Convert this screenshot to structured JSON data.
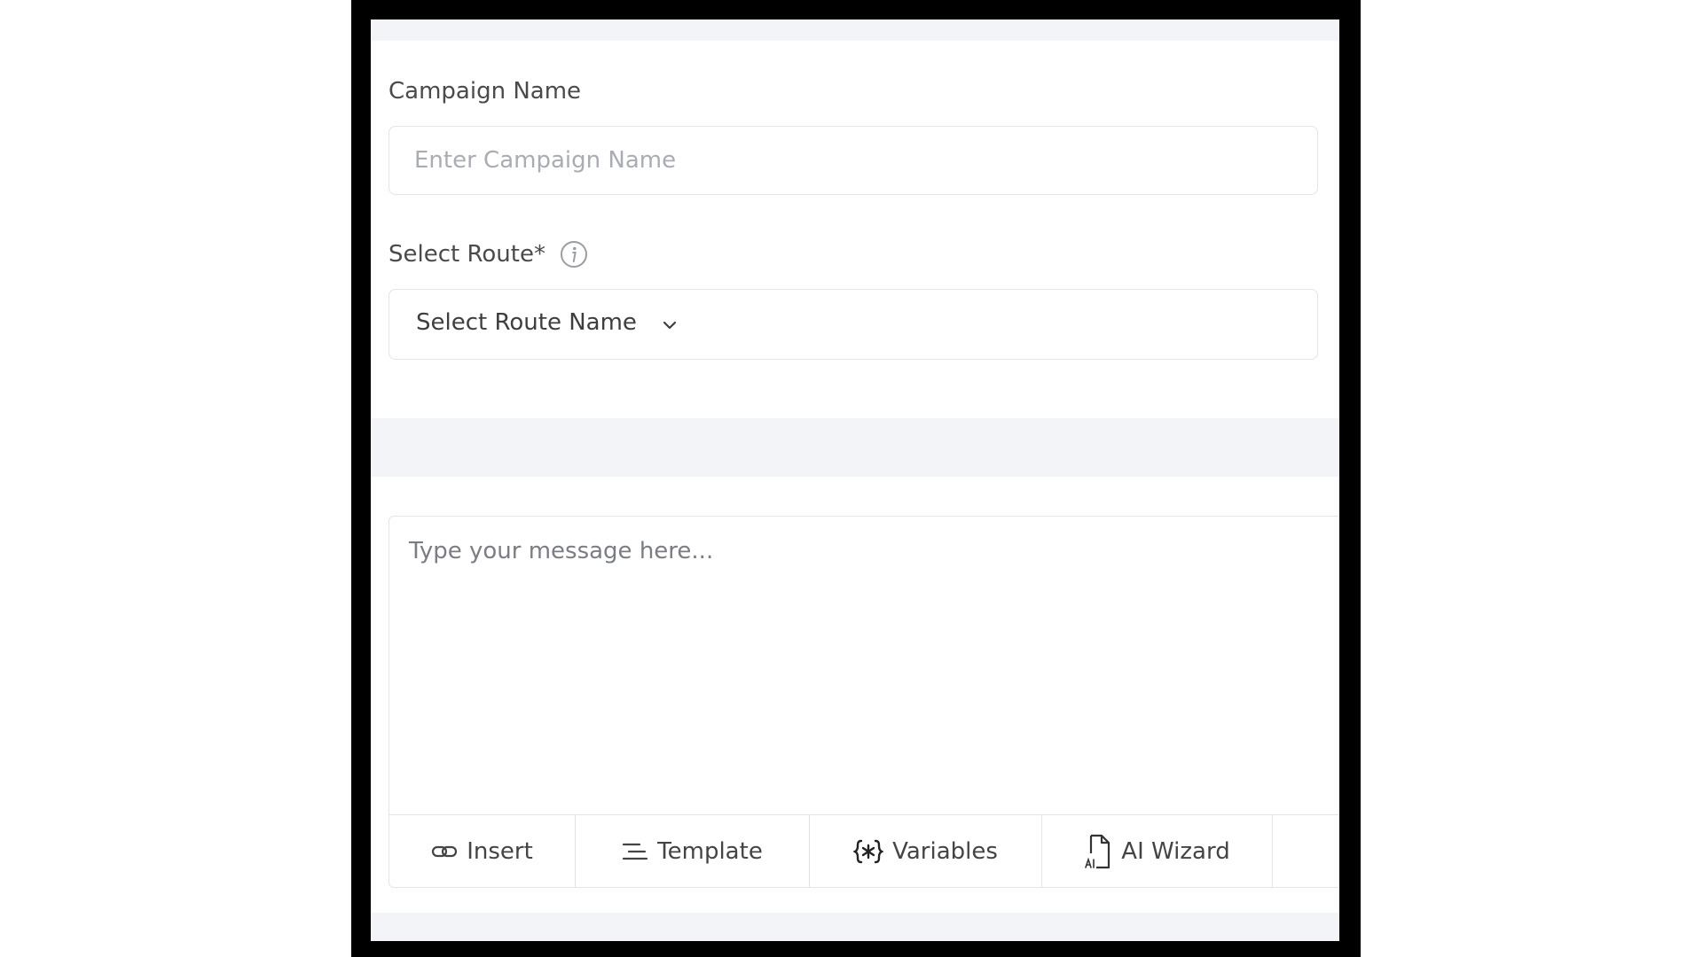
{
  "form": {
    "campaign_name": {
      "label": "Campaign Name",
      "placeholder": "Enter Campaign Name",
      "value": ""
    },
    "route": {
      "label": "Select Route*",
      "selected": "Select Route Name",
      "info_icon": "info-circle-icon",
      "chevron_icon": "chevron-down-icon"
    }
  },
  "message": {
    "placeholder": "Type your message here...",
    "value": ""
  },
  "toolbar": {
    "insert_label": "Insert",
    "template_label": "Template",
    "variables_label": "Variables",
    "ai_wizard_label": "AI Wizard"
  },
  "colors": {
    "frame": "#000000",
    "panel_background": "#f3f4f7",
    "card_background": "#ffffff",
    "border": "#e2e4e8",
    "label_text": "#4a4a4a",
    "placeholder_text": "#a9acb3"
  }
}
